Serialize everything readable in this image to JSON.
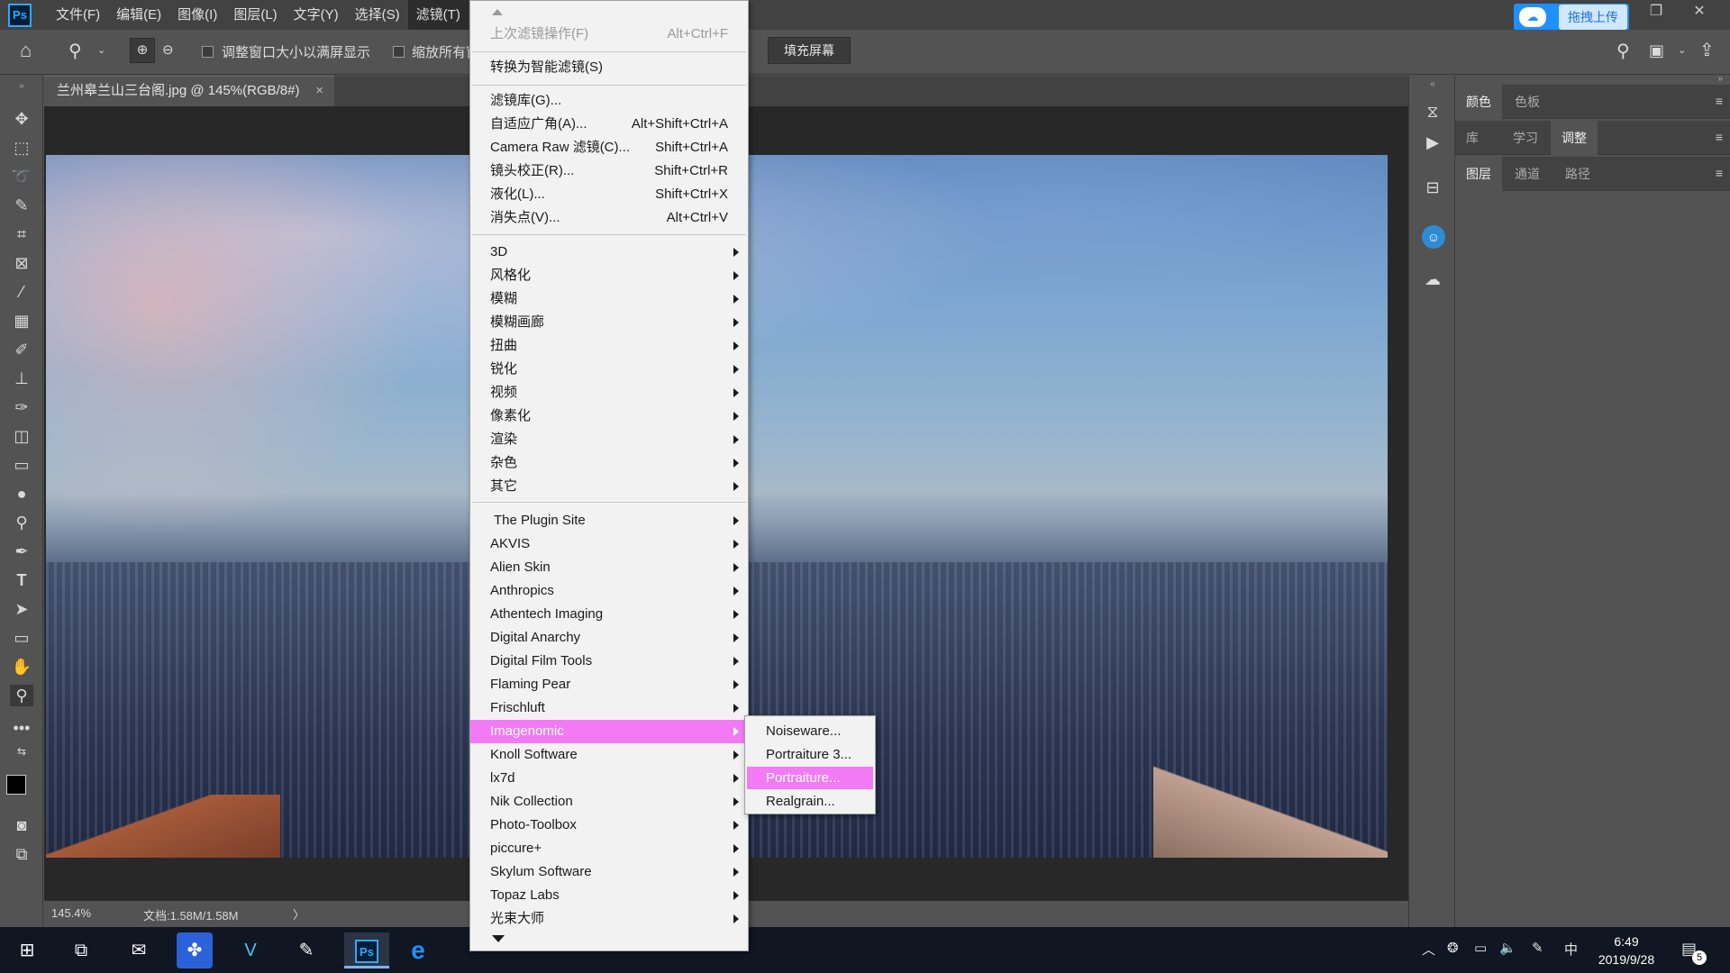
{
  "app": {
    "logo": "Ps"
  },
  "menubar": {
    "items": [
      "文件(F)",
      "编辑(E)",
      "图像(I)",
      "图层(L)",
      "文字(Y)",
      "选择(S)",
      "滤镜(T)"
    ],
    "active_index": 6
  },
  "upload": {
    "label": "拖拽上传"
  },
  "options": {
    "resize_label": "调整窗口大小以满屏显示",
    "zoom_all_label": "缩放所有窗口",
    "fill_screen": "填充屏幕"
  },
  "document": {
    "tab_title": "兰州皋兰山三台阁.jpg @ 145%(RGB/8#)",
    "close": "×",
    "zoom": "145.4%",
    "doc_info": "文档:1.58M/1.58M",
    "status_arrow": "〉"
  },
  "panels": {
    "row1": [
      "颜色",
      "色板"
    ],
    "row2": [
      "库",
      "学习",
      "调整"
    ],
    "row3": [
      "图层",
      "通道",
      "路径"
    ]
  },
  "filter_menu": {
    "items": [
      {
        "label": "上次滤镜操作(F)",
        "shortcut": "Alt+Ctrl+F",
        "disabled": true
      },
      {
        "label": "转换为智能滤镜(S)",
        "shortcut": ""
      },
      {
        "label": "滤镜库(G)...",
        "shortcut": ""
      },
      {
        "label": "自适应广角(A)...",
        "shortcut": "Alt+Shift+Ctrl+A"
      },
      {
        "label": "Camera Raw 滤镜(C)...",
        "shortcut": "Shift+Ctrl+A"
      },
      {
        "label": "镜头校正(R)...",
        "shortcut": "Shift+Ctrl+R"
      },
      {
        "label": "液化(L)...",
        "shortcut": "Shift+Ctrl+X"
      },
      {
        "label": "消失点(V)...",
        "shortcut": "Alt+Ctrl+V"
      },
      {
        "label": "3D"
      },
      {
        "label": "风格化"
      },
      {
        "label": "模糊"
      },
      {
        "label": "模糊画廊"
      },
      {
        "label": "扭曲"
      },
      {
        "label": "锐化"
      },
      {
        "label": "视频"
      },
      {
        "label": "像素化"
      },
      {
        "label": "渲染"
      },
      {
        "label": "杂色"
      },
      {
        "label": "其它"
      },
      {
        "label": "The Plugin Site"
      },
      {
        "label": "AKVIS"
      },
      {
        "label": "Alien Skin"
      },
      {
        "label": "Anthropics"
      },
      {
        "label": "Athentech Imaging"
      },
      {
        "label": "Digital Anarchy"
      },
      {
        "label": "Digital Film Tools"
      },
      {
        "label": "Flaming Pear"
      },
      {
        "label": "Frischluft"
      },
      {
        "label": "Imagenomic",
        "highlighted": true
      },
      {
        "label": "Knoll Software"
      },
      {
        "label": "lx7d"
      },
      {
        "label": "Nik Collection"
      },
      {
        "label": "Photo-Toolbox"
      },
      {
        "label": "piccure+"
      },
      {
        "label": "Skylum Software"
      },
      {
        "label": "Topaz Labs"
      },
      {
        "label": "光束大师"
      }
    ]
  },
  "submenu": {
    "items": [
      "Noiseware...",
      "Portraiture 3...",
      "Portraiture...",
      "Realgrain..."
    ],
    "highlighted_index": 2
  },
  "taskbar": {
    "time": "6:49",
    "date": "2019/9/28",
    "ime": "中",
    "notifications": "5"
  },
  "colors": {
    "highlight": "#f27bf5",
    "menu_bg": "#f2f2f2",
    "ps_dark": "#535353"
  }
}
